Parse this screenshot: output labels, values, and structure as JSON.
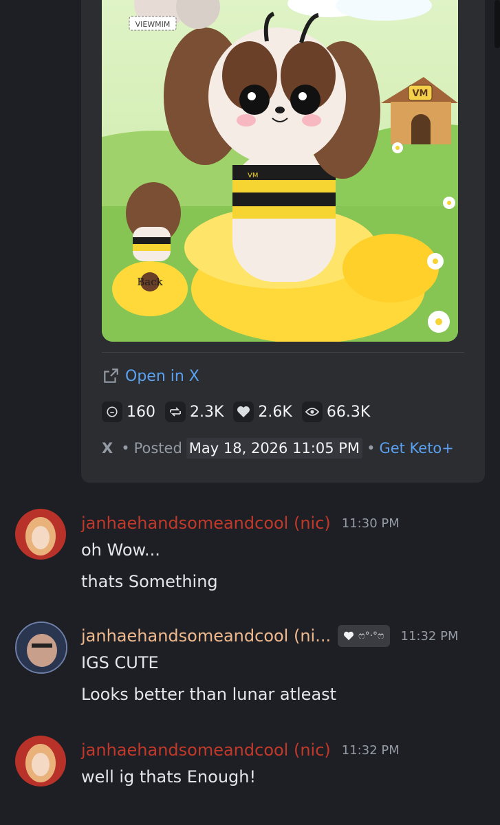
{
  "embed": {
    "image_texts": {
      "watermark": "VIEWMIM",
      "doghouse_logo": "VM",
      "shirt_logo": "VM",
      "back_label": "Back"
    },
    "open_link_label": "Open in X",
    "stats": [
      {
        "icon": "reply-icon",
        "value": "160"
      },
      {
        "icon": "retweet-icon",
        "value": "2.3K"
      },
      {
        "icon": "heart-icon",
        "value": "2.6K"
      },
      {
        "icon": "eye-icon",
        "value": "66.3K"
      }
    ],
    "footer": {
      "source": "X",
      "separator": "•",
      "posted_label": "Posted",
      "date": "May 18, 2026 11:05 PM",
      "cta": "Get Keto+"
    }
  },
  "messages": [
    {
      "username": "janhaehandsomeandcool (nic)",
      "username_color": "#c0392b",
      "time": "11:30 PM",
      "lines": [
        "oh Wow...",
        "thats Something"
      ]
    },
    {
      "username": "janhaehandsomeandcool (ni...",
      "username_color": "#f0b98d",
      "time": "11:32 PM",
      "badge_text": "ෆ°·°ෆ",
      "lines": [
        "IGS CUTE",
        "Looks better than lunar atleast"
      ]
    },
    {
      "username": "janhaehandsomeandcool (nic)",
      "username_color": "#c0392b",
      "time": "11:32 PM",
      "lines": [
        "well ig thats Enough!"
      ]
    }
  ],
  "colors": {
    "background": "#1e1f24",
    "embed_bg": "#2b2d31",
    "link": "#5aa1f0"
  }
}
